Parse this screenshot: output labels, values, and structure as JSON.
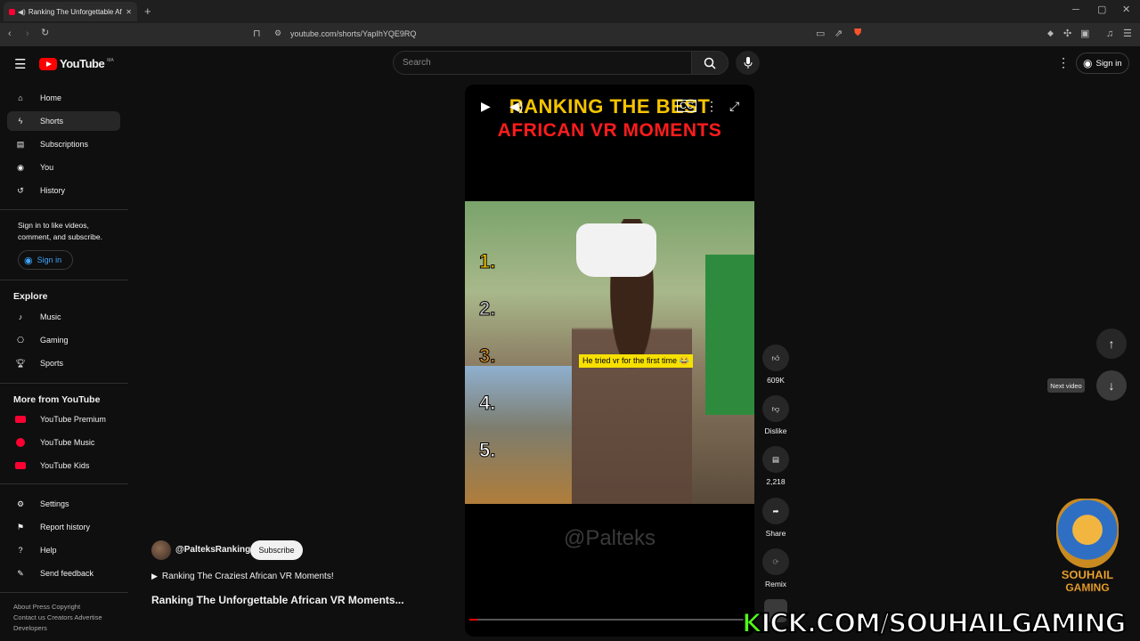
{
  "browser": {
    "tab_title": "Ranking The Unforgettable Af",
    "new_tab": "+",
    "url": "youtube.com/shorts/YapIhYQE9RQ",
    "window_controls": [
      "minimize-icon",
      "maximize-icon",
      "close-icon"
    ]
  },
  "header": {
    "logo_text": "YouTube",
    "logo_region": "MA",
    "search_placeholder": "Search",
    "sign_in": "Sign in"
  },
  "sidebar": {
    "items": [
      {
        "label": "Home",
        "icon": "home-icon"
      },
      {
        "label": "Shorts",
        "icon": "shorts-icon",
        "active": true
      },
      {
        "label": "Subscriptions",
        "icon": "subscriptions-icon"
      },
      {
        "label": "You",
        "icon": "you-icon"
      },
      {
        "label": "History",
        "icon": "history-icon"
      }
    ],
    "signin_message": "Sign in to like videos, comment, and subscribe.",
    "signin_button": "Sign in",
    "explore_heading": "Explore",
    "explore": [
      {
        "label": "Music",
        "icon": "music-icon"
      },
      {
        "label": "Gaming",
        "icon": "gaming-icon"
      },
      {
        "label": "Sports",
        "icon": "sports-icon"
      }
    ],
    "more_heading": "More from YouTube",
    "more": [
      {
        "label": "YouTube Premium",
        "icon": "youtube-premium-icon"
      },
      {
        "label": "YouTube Music",
        "icon": "youtube-music-icon"
      },
      {
        "label": "YouTube Kids",
        "icon": "youtube-kids-icon"
      }
    ],
    "settings": [
      {
        "label": "Settings",
        "icon": "gear-icon"
      },
      {
        "label": "Report history",
        "icon": "flag-icon"
      },
      {
        "label": "Help",
        "icon": "help-icon"
      },
      {
        "label": "Send feedback",
        "icon": "feedback-icon"
      }
    ],
    "footer_line1": "About  Press  Copyright",
    "footer_line2": "Contact us  Creators  Advertise",
    "footer_line3": "Developers"
  },
  "video": {
    "title_line1": "RANKING THE BEST",
    "title_line2": "AFRICAN VR MOMENTS",
    "caption": "He tried  vr for the  first time 😂",
    "ranks": [
      "1.",
      "2.",
      "3.",
      "4.",
      "5."
    ],
    "watermark": "@Palteks",
    "progress": 0.03
  },
  "actions": {
    "like_count": "609K",
    "dislike_label": "Dislike",
    "comment_count": "2,218",
    "share_label": "Share",
    "remix_label": "Remix"
  },
  "channel": {
    "handle": "@PalteksRanking",
    "subscribe": "Subscribe",
    "playlist": "Ranking The Craziest African VR Moments!",
    "video_title": "Ranking The Unforgettable African VR Moments..."
  },
  "nav": {
    "tooltip": "Next video"
  },
  "overlay": {
    "logo_text_1": "SOUHAIL",
    "logo_text_2": "GAMING",
    "kick_k": "K",
    "kick_rest": "ICK.COM/SOUHAILGAMING"
  },
  "colors": {
    "accent_red": "#ff0000",
    "link_blue": "#3ea6ff",
    "kick_green": "#53fc18",
    "title_yellow": "#f5c400"
  }
}
